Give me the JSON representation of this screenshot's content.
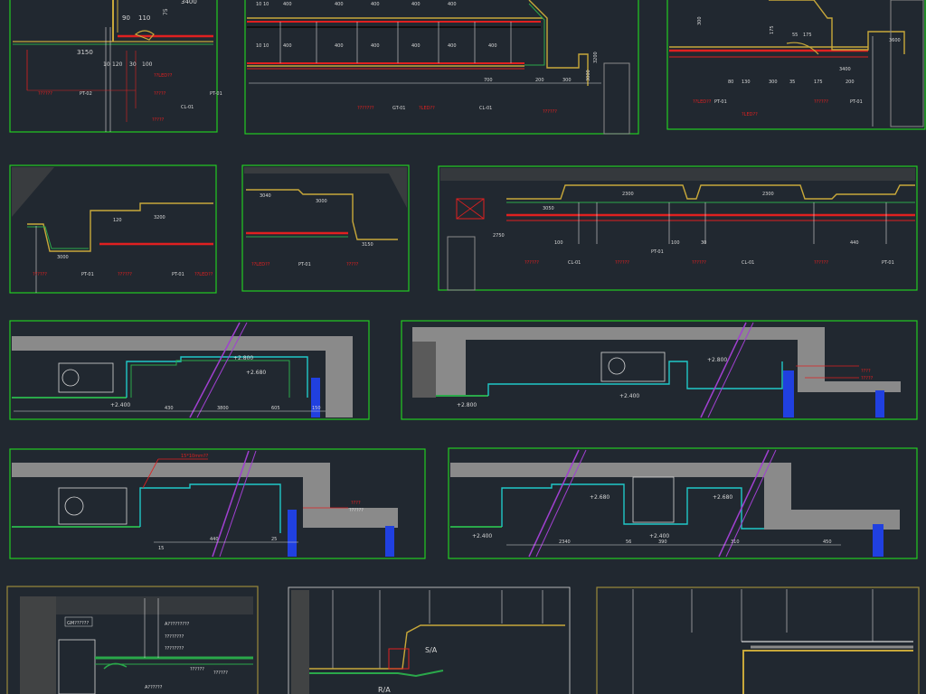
{
  "colors": {
    "background": "#212830",
    "frame_green": "#22cc22",
    "frame_olive": "#9a8a3a",
    "wall_gray": "#8a8a8a",
    "ceiling_green": "#2aa84a",
    "outline_yellow": "#c8a83a",
    "dim_red": "#e02020",
    "dim_white": "#d8d8d8",
    "purple": "#a040d0",
    "cyan": "#20c8c8",
    "blue": "#2040e0"
  },
  "panel1": {
    "dims_top": [
      "3400",
      "90",
      "110"
    ],
    "dim_span": "3150",
    "dims_bottom": [
      "10",
      "120",
      "30",
      "100"
    ],
    "dim_side": "75",
    "tags": [
      "??????",
      "PT-02",
      "PT-01",
      "??LED??",
      "?????",
      "CL-01",
      "?????"
    ]
  },
  "panel2": {
    "dims_row1": [
      "10 10",
      "400",
      "400",
      "400",
      "400",
      "400"
    ],
    "dims_row2": [
      "10 10",
      "400",
      "400",
      "400",
      "400",
      "400",
      "400"
    ],
    "dims_bottom": [
      "700",
      "200",
      "300"
    ],
    "dims_right": [
      "3200",
      "3000"
    ],
    "tags": [
      "???????",
      "GT-01",
      "?LED??",
      "CL-01",
      "??????"
    ]
  },
  "panel3": {
    "dims_top": [
      "300",
      "175",
      "55",
      "175"
    ],
    "dims_row": [
      "80",
      "130",
      "300",
      "35",
      "175",
      "200"
    ],
    "dims_right": [
      "3400",
      "3600"
    ],
    "tags": [
      "??LED??",
      "PT-01",
      "??????",
      "PT-01",
      "?LED??"
    ]
  },
  "panel4": {
    "dims_top": [
      "3200",
      "120"
    ],
    "dims_bottom": [
      "3000"
    ],
    "tags": [
      "??????",
      "PT-01",
      "??????",
      "PT-01",
      "??LED??"
    ]
  },
  "panel5": {
    "dims_top": [
      "3040",
      "3000"
    ],
    "dims_right": [
      "3150"
    ],
    "tags": [
      "??LED??",
      "PT-01",
      "?????"
    ]
  },
  "panel6": {
    "dims_top": [
      "2300",
      "2300"
    ],
    "dims_left": [
      "2750",
      "3050"
    ],
    "dims_bottom": [
      "100",
      "100",
      "30",
      "440"
    ],
    "tags": [
      "??????",
      "CL-01",
      "??????",
      "PT-01",
      "??????",
      "CL-01",
      "??????",
      "PT-01"
    ]
  },
  "panel7": {
    "level_top": "+2.800",
    "level_mid": "+2.680",
    "level_bottom": "+2.400",
    "dims": [
      "430",
      "3800",
      "605",
      "150"
    ]
  },
  "panel8": {
    "level_top": "+2.800",
    "level_bottom": "+2.400",
    "level_left": "+2.800",
    "tags": [
      "????",
      "?????"
    ]
  },
  "panel9": {
    "tags": [
      "15*10mm??",
      "????",
      "??????"
    ],
    "dims": [
      "440",
      "25",
      "15"
    ]
  },
  "panel10": {
    "level_a": "+2.680",
    "level_b": "+2.680",
    "level_c": "+2.400",
    "level_d": "+2.400",
    "dims": [
      "2340",
      "56",
      "390",
      "310",
      "450"
    ]
  },
  "panel11": {
    "tags": [
      "GM??????",
      "A?????????",
      "????????",
      "????????",
      "??????",
      "??????",
      "A??????"
    ]
  },
  "panel12": {
    "label_a": "S/A",
    "label_b": "R/A"
  }
}
